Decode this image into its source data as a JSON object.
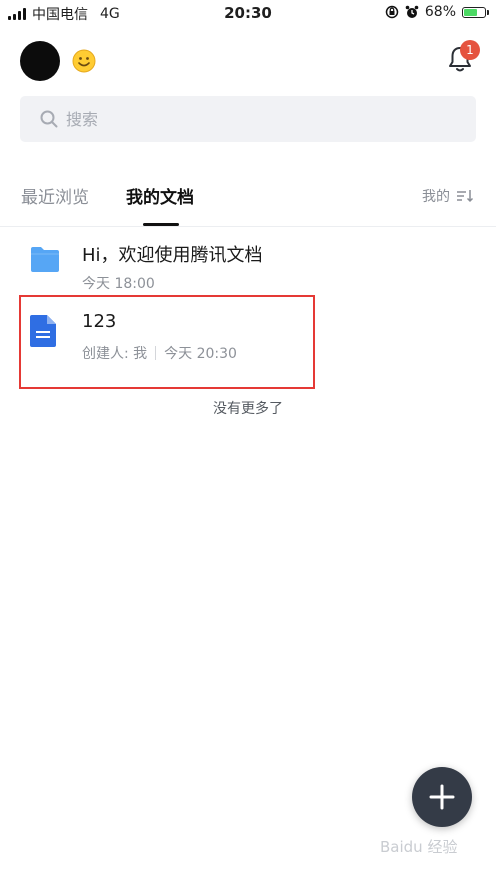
{
  "status_bar": {
    "carrier": "中国电信",
    "network": "4G",
    "time": "20:30",
    "battery_percent": "68%",
    "battery_level": 0.68
  },
  "header": {
    "notification_count": "1"
  },
  "search": {
    "placeholder": "搜索"
  },
  "tabs": [
    {
      "label": "最近浏览",
      "active": false
    },
    {
      "label": "我的文档",
      "active": true
    }
  ],
  "sort": {
    "label": "我的"
  },
  "documents": [
    {
      "title": "Hi，欢迎使用腾讯文档",
      "time": "今天 18:00",
      "creator": "",
      "icon": "folder-icon"
    },
    {
      "title": "123",
      "creator": "创建人: 我",
      "time": "今天 20:30",
      "icon": "doc-icon"
    }
  ],
  "list_footer": "没有更多了",
  "watermark": "Baidu 经验",
  "colors": {
    "folder": "#56a6f5",
    "doc": "#2f6ee3",
    "badge": "#e5533f",
    "fab": "#343b47",
    "highlight": "#e53935"
  }
}
